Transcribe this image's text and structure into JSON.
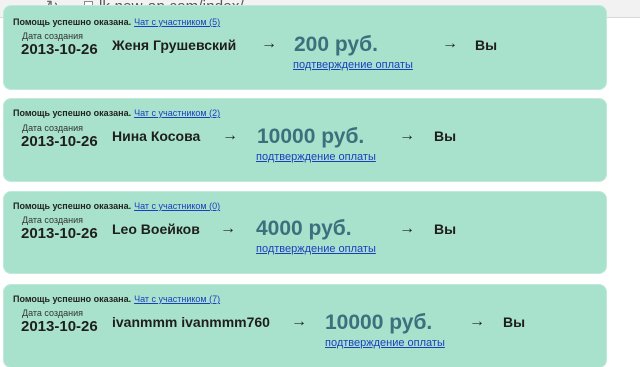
{
  "browser": {
    "back_icon": "arrow-left-icon",
    "forward_icon": "arrow-right-icon",
    "reload_icon": "reload-icon",
    "url": "lk.new-ap.com/index/"
  },
  "cards": [
    {
      "status": "Помощь успешно оказана.",
      "chat_link": "Чат с участником (5)",
      "date_label": "Дата создания",
      "date": "2013-10-26",
      "sender": "Женя Грушевский",
      "arrow1": "→",
      "amount": "200 руб.",
      "confirm_link": "подтверждение оплаты",
      "arrow2": "→",
      "recipient": "Вы"
    },
    {
      "status": "Помощь успешно оказана.",
      "chat_link": "Чат с участником (2)",
      "date_label": "Дата создания",
      "date": "2013-10-26",
      "sender": "Нина Косова",
      "arrow1": "→",
      "amount": "10000 руб.",
      "confirm_link": "подтверждение оплаты",
      "arrow2": "→",
      "recipient": "Вы"
    },
    {
      "status": "Помощь успешно оказана.",
      "chat_link": "Чат с участником (0)",
      "date_label": "Дата создания",
      "date": "2013-10-26",
      "sender": "Leo Воейков",
      "arrow1": "→",
      "amount": "4000 руб.",
      "confirm_link": "подтверждение оплаты",
      "arrow2": "→",
      "recipient": "Вы"
    },
    {
      "status": "Помощь успешно оказана.",
      "chat_link": "Чат с участником (7)",
      "date_label": "Дата создания",
      "date": "2013-10-26",
      "sender": "ivanmmm ivanmmm760",
      "arrow1": "→",
      "amount": "10000 руб.",
      "confirm_link": "подтверждение оплаты",
      "arrow2": "→",
      "recipient": "Вы"
    }
  ],
  "colors": {
    "card_background": "#a8e2cc",
    "amount_text": "#3d6f7d",
    "link": "#1a3fbf"
  }
}
